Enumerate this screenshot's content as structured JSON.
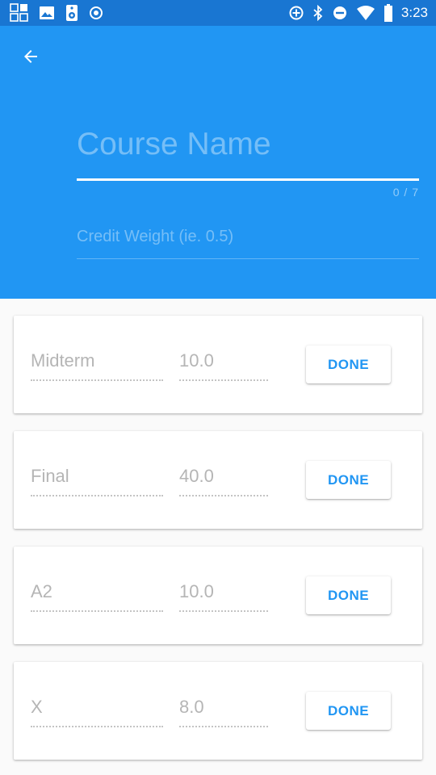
{
  "status_bar": {
    "time": "3:23",
    "left_icons": [
      "tiles-icon",
      "image-icon",
      "speaker-icon",
      "record-icon"
    ],
    "right_icons": [
      "data-saver-icon",
      "bluetooth-icon",
      "do-not-disturb-icon",
      "wifi-icon",
      "battery-icon"
    ],
    "color": "#1976d2"
  },
  "header": {
    "color": "#2196f3",
    "course_name_placeholder": "Course Name",
    "course_name_value": "",
    "char_counter": "0 / 7",
    "credit_weight_placeholder": "Credit Weight (ie. 0.5)",
    "credit_weight_value": ""
  },
  "assessments": [
    {
      "name": "Midterm",
      "weight": "10.0",
      "button": "DONE"
    },
    {
      "name": "Final",
      "weight": "40.0",
      "button": "DONE"
    },
    {
      "name": "A2",
      "weight": "10.0",
      "button": "DONE"
    },
    {
      "name": "X",
      "weight": "8.0",
      "button": "DONE"
    }
  ],
  "accent_color": "#2196f3"
}
